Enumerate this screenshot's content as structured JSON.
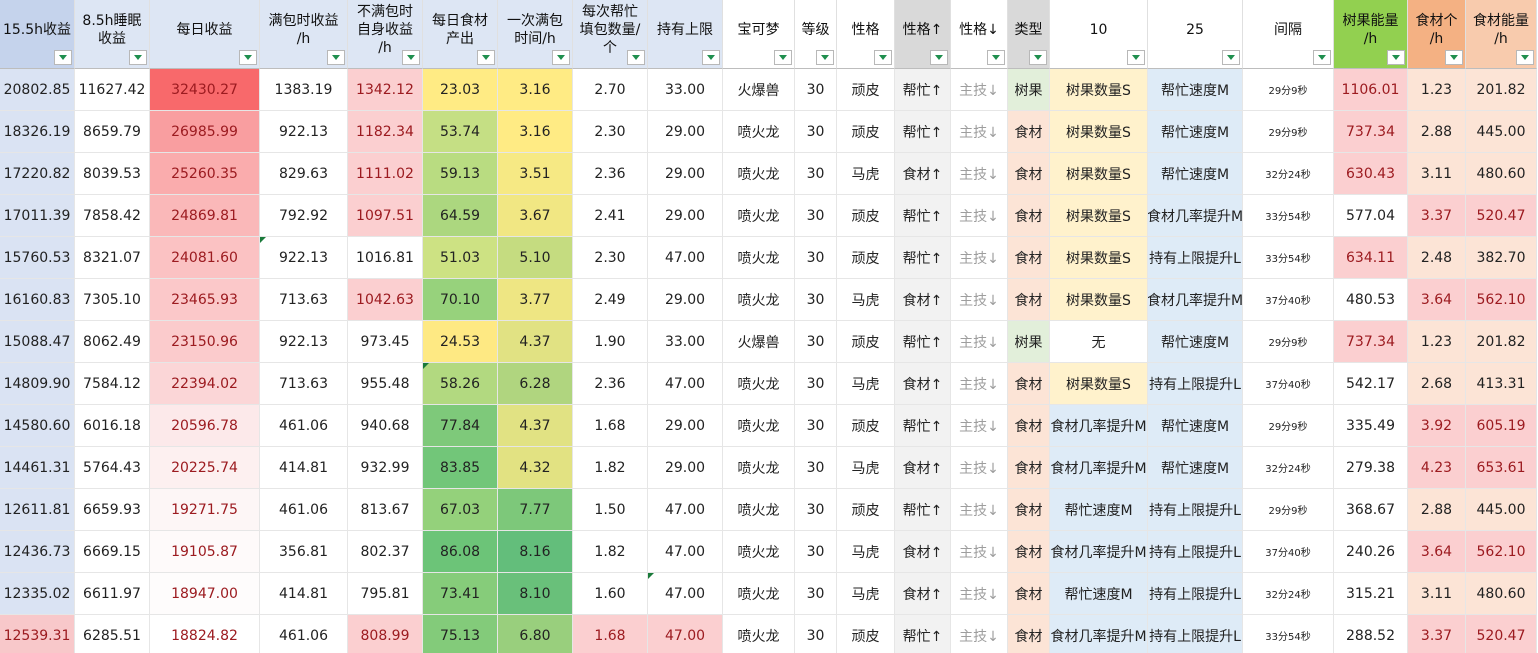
{
  "columns": [
    {
      "label": "15.5h收益",
      "w": 75,
      "bg": "#c5d3ec"
    },
    {
      "label": "8.5h睡眠\n收益",
      "w": 75,
      "bg": "#dde6f4"
    },
    {
      "label": "每日收益",
      "w": 110,
      "bg": "#dde6f4"
    },
    {
      "label": "满包时收益\n/h",
      "w": 88,
      "bg": "#dde6f4"
    },
    {
      "label": "不满包时\n自身收益\n/h",
      "w": 75,
      "bg": "#dde6f4"
    },
    {
      "label": "每日食材\n产出",
      "w": 75,
      "bg": "#dde6f4"
    },
    {
      "label": "一次满包\n时间/h",
      "w": 75,
      "bg": "#dde6f4"
    },
    {
      "label": "每次帮忙\n填包数量/\n个",
      "w": 75,
      "bg": "#dde6f4"
    },
    {
      "label": "持有上限",
      "w": 75,
      "bg": "#dde6f4"
    },
    {
      "label": "宝可梦",
      "w": 72,
      "bg": "#ffffff"
    },
    {
      "label": "等级",
      "w": 42,
      "bg": "#ffffff"
    },
    {
      "label": "性格",
      "w": 58,
      "bg": "#ffffff"
    },
    {
      "label": "性格↑",
      "w": 56,
      "bg": "#d9d9d9"
    },
    {
      "label": "性格↓",
      "w": 57,
      "bg": "#ffffff"
    },
    {
      "label": "类型",
      "w": 42,
      "bg": "#d9d9d9"
    },
    {
      "label": "10",
      "w": 98,
      "bg": "#ffffff"
    },
    {
      "label": "25",
      "w": 95,
      "bg": "#ffffff"
    },
    {
      "label": "间隔",
      "w": 91,
      "bg": "#ffffff"
    },
    {
      "label": "树果能量\n/h",
      "w": 74,
      "bg": "#92d050"
    },
    {
      "label": "食材个\n/h",
      "w": 58,
      "bg": "#f4b183"
    },
    {
      "label": "食材能量\n/h",
      "w": 71,
      "bg": "#f8cbad"
    }
  ],
  "rows": [
    [
      "20802.85",
      "11627.42",
      "32430.27",
      "1383.19",
      "1342.12",
      "23.03",
      "3.16",
      "2.70",
      "33.00",
      "火爆兽",
      "30",
      "顽皮",
      "帮忙↑",
      "主技↓",
      "树果",
      "树果数量S",
      "帮忙速度M",
      "29分9秒",
      "1106.01",
      "1.23",
      "201.82"
    ],
    [
      "18326.19",
      "8659.79",
      "26985.99",
      "922.13",
      "1182.34",
      "53.74",
      "3.16",
      "2.30",
      "29.00",
      "喷火龙",
      "30",
      "顽皮",
      "帮忙↑",
      "主技↓",
      "食材",
      "树果数量S",
      "帮忙速度M",
      "29分9秒",
      "737.34",
      "2.88",
      "445.00"
    ],
    [
      "17220.82",
      "8039.53",
      "25260.35",
      "829.63",
      "1111.02",
      "59.13",
      "3.51",
      "2.36",
      "29.00",
      "喷火龙",
      "30",
      "马虎",
      "食材↑",
      "主技↓",
      "食材",
      "树果数量S",
      "帮忙速度M",
      "32分24秒",
      "630.43",
      "3.11",
      "480.60"
    ],
    [
      "17011.39",
      "7858.42",
      "24869.81",
      "792.92",
      "1097.51",
      "64.59",
      "3.67",
      "2.41",
      "29.00",
      "喷火龙",
      "30",
      "顽皮",
      "帮忙↑",
      "主技↓",
      "食材",
      "树果数量S",
      "食材几率提升M",
      "33分54秒",
      "577.04",
      "3.37",
      "520.47"
    ],
    [
      "15760.53",
      "8321.07",
      "24081.60",
      "922.13",
      "1016.81",
      "51.03",
      "5.10",
      "2.30",
      "47.00",
      "喷火龙",
      "30",
      "顽皮",
      "帮忙↑",
      "主技↓",
      "食材",
      "树果数量S",
      "持有上限提升L",
      "33分54秒",
      "634.11",
      "2.48",
      "382.70"
    ],
    [
      "16160.83",
      "7305.10",
      "23465.93",
      "713.63",
      "1042.63",
      "70.10",
      "3.77",
      "2.49",
      "29.00",
      "喷火龙",
      "30",
      "马虎",
      "食材↑",
      "主技↓",
      "食材",
      "树果数量S",
      "食材几率提升M",
      "37分40秒",
      "480.53",
      "3.64",
      "562.10"
    ],
    [
      "15088.47",
      "8062.49",
      "23150.96",
      "922.13",
      "973.45",
      "24.53",
      "4.37",
      "1.90",
      "33.00",
      "火爆兽",
      "30",
      "顽皮",
      "帮忙↑",
      "主技↓",
      "树果",
      "无",
      "帮忙速度M",
      "29分9秒",
      "737.34",
      "1.23",
      "201.82"
    ],
    [
      "14809.90",
      "7584.12",
      "22394.02",
      "713.63",
      "955.48",
      "58.26",
      "6.28",
      "2.36",
      "47.00",
      "喷火龙",
      "30",
      "马虎",
      "食材↑",
      "主技↓",
      "食材",
      "树果数量S",
      "持有上限提升L",
      "37分40秒",
      "542.17",
      "2.68",
      "413.31"
    ],
    [
      "14580.60",
      "6016.18",
      "20596.78",
      "461.06",
      "940.68",
      "77.84",
      "4.37",
      "1.68",
      "29.00",
      "喷火龙",
      "30",
      "顽皮",
      "帮忙↑",
      "主技↓",
      "食材",
      "食材几率提升M",
      "帮忙速度M",
      "29分9秒",
      "335.49",
      "3.92",
      "605.19"
    ],
    [
      "14461.31",
      "5764.43",
      "20225.74",
      "414.81",
      "932.99",
      "83.85",
      "4.32",
      "1.82",
      "29.00",
      "喷火龙",
      "30",
      "马虎",
      "食材↑",
      "主技↓",
      "食材",
      "食材几率提升M",
      "帮忙速度M",
      "32分24秒",
      "279.38",
      "4.23",
      "653.61"
    ],
    [
      "12611.81",
      "6659.93",
      "19271.75",
      "461.06",
      "813.67",
      "67.03",
      "7.77",
      "1.50",
      "47.00",
      "喷火龙",
      "30",
      "顽皮",
      "帮忙↑",
      "主技↓",
      "食材",
      "帮忙速度M",
      "持有上限提升L",
      "29分9秒",
      "368.67",
      "2.88",
      "445.00"
    ],
    [
      "12436.73",
      "6669.15",
      "19105.87",
      "356.81",
      "802.37",
      "86.08",
      "8.16",
      "1.82",
      "47.00",
      "喷火龙",
      "30",
      "马虎",
      "食材↑",
      "主技↓",
      "食材",
      "食材几率提升M",
      "持有上限提升L",
      "37分40秒",
      "240.26",
      "3.64",
      "562.10"
    ],
    [
      "12335.02",
      "6611.97",
      "18947.00",
      "414.81",
      "795.81",
      "73.41",
      "8.10",
      "1.60",
      "47.00",
      "喷火龙",
      "30",
      "马虎",
      "食材↑",
      "主技↓",
      "食材",
      "帮忙速度M",
      "持有上限提升L",
      "32分24秒",
      "315.21",
      "3.11",
      "480.60"
    ],
    [
      "12539.31",
      "6285.51",
      "18824.82",
      "461.06",
      "808.99",
      "75.13",
      "6.80",
      "1.68",
      "47.00",
      "喷火龙",
      "30",
      "顽皮",
      "帮忙↑",
      "主技↓",
      "食材",
      "食材几率提升M",
      "持有上限提升L",
      "33分54秒",
      "288.52",
      "3.37",
      "520.47"
    ]
  ],
  "column_styles": {
    "0": {
      "bg": "#dae3f3"
    },
    "1": {
      "bg": "#ffffff"
    },
    "3": {
      "bg": "#ffffff"
    },
    "9": {
      "bg": "#ffffff"
    },
    "10": {
      "bg": "#ffffff"
    },
    "11": {
      "bg": "#ffffff"
    },
    "12": {
      "bg": "#f2f2f2"
    },
    "13": {
      "bg": "#ffffff"
    },
    "16": {
      "bg": "#deebf7"
    },
    "17": {
      "bg": "#ffffff"
    },
    "19": {
      "bg": "#fce4d6"
    },
    "20": {
      "bg": "#fce4d6"
    }
  },
  "cell_colors": {
    "2": [
      "#f8696b",
      "#f99ea0",
      "#faacad",
      "#fab8b9",
      "#fbc2c3",
      "#fbc8c9",
      "#fbcbcc",
      "#fbd6d7",
      "#fce9ea",
      "#fdf0f0",
      "#fdf6f6",
      "#fefafa",
      "#fefcfc",
      "#ffffff"
    ],
    "4": [
      "#fbcfd0",
      "#fbcfd0",
      "#fbcfd0",
      "#fbcfd0",
      "#ffffff",
      "#fbcfd0",
      "#ffffff",
      "#ffffff",
      "#ffffff",
      "#ffffff",
      "#ffffff",
      "#ffffff",
      "#ffffff",
      "#fbcfd0"
    ],
    "5": [
      "#ffeb84",
      "#c5df84",
      "#b9dc81",
      "#acd77f",
      "#cde283",
      "#97d27c",
      "#fee983",
      "#b2d980",
      "#7ec97a",
      "#72c679",
      "#94d17b",
      "#6cc478",
      "#86cc7a",
      "#83cb7a"
    ],
    "6": [
      "#ffeb84",
      "#ffeb84",
      "#f6e984",
      "#f1e783",
      "#c5dc80",
      "#eee683",
      "#e1e283",
      "#b0d57f",
      "#e1e283",
      "#e2e282",
      "#7dc87a",
      "#63be7b",
      "#69c07a",
      "#99cf7d"
    ],
    "7": [
      "#ffffff",
      "#ffffff",
      "#ffffff",
      "#ffffff",
      "#ffffff",
      "#ffffff",
      "#ffffff",
      "#ffffff",
      "#ffffff",
      "#ffffff",
      "#ffffff",
      "#ffffff",
      "#ffffff",
      "#fbcfd0"
    ],
    "8": [
      "#ffffff",
      "#ffffff",
      "#ffffff",
      "#ffffff",
      "#ffffff",
      "#ffffff",
      "#ffffff",
      "#ffffff",
      "#ffffff",
      "#ffffff",
      "#ffffff",
      "#ffffff",
      "#ffffff",
      "#fbcfd0"
    ],
    "14": [
      "#e2efda",
      "#fce4d6",
      "#fce4d6",
      "#fce4d6",
      "#fce4d6",
      "#fce4d6",
      "#e2efda",
      "#fce4d6",
      "#fce4d6",
      "#fce4d6",
      "#fce4d6",
      "#fce4d6",
      "#fce4d6",
      "#fce4d6"
    ],
    "15": [
      "#fff2cc",
      "#fff2cc",
      "#fff2cc",
      "#fff2cc",
      "#fff2cc",
      "#fff2cc",
      "#ffffff",
      "#fff2cc",
      "#deebf7",
      "#deebf7",
      "#deebf7",
      "#deebf7",
      "#deebf7",
      "#deebf7"
    ],
    "18": [
      "#fbcfd0",
      "#fbcfd0",
      "#fbcfd0",
      "#ffffff",
      "#fbcfd0",
      "#ffffff",
      "#fbcfd0",
      "#ffffff",
      "#ffffff",
      "#ffffff",
      "#ffffff",
      "#ffffff",
      "#ffffff",
      "#ffffff"
    ],
    "19": [
      "#fce4d6",
      "#fce4d6",
      "#fce4d6",
      "#fbcfd0",
      "#fce4d6",
      "#fbcfd0",
      "#fce4d6",
      "#fce4d6",
      "#fbcfd0",
      "#fbcfd0",
      "#fce4d6",
      "#fbcfd0",
      "#fce4d6",
      "#fbcfd0"
    ],
    "20": [
      "#fce4d6",
      "#fce4d6",
      "#fce4d6",
      "#fbcfd0",
      "#fce4d6",
      "#fbcfd0",
      "#fce4d6",
      "#fce4d6",
      "#fbcfd0",
      "#fbcfd0",
      "#fce4d6",
      "#fbcfd0",
      "#fce4d6",
      "#fbcfd0"
    ]
  },
  "row_overrides": {
    "13": {
      "0": "#f8c8ca"
    }
  },
  "red_text_cells": {
    "2": "all",
    "4": [
      0,
      1,
      2,
      3,
      5,
      13
    ],
    "18": [
      0,
      1,
      2,
      4,
      6
    ],
    "19": [
      3,
      5,
      8,
      9,
      11,
      13
    ],
    "20": [
      3,
      5,
      8,
      9,
      11,
      13
    ],
    "7": [
      13
    ],
    "8": [
      13
    ],
    "0": [
      13
    ]
  },
  "grey_text_cols": [
    13
  ],
  "small_text_cols": [
    17
  ]
}
